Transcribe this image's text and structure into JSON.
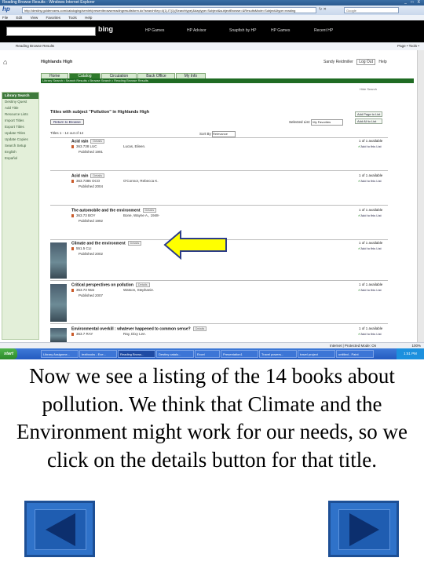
{
  "browser": {
    "window_title": "Reading Browse Results - Windows Internet Explorer",
    "address": "http://destiny.goldenrams.com/cataloging/servlet/presentbrowsereadingresultsform.do?searchKey=4(1).IT(1)(Searchtype)&daytype=Subject&subjectBrowse=&ResultsMode=Subject&type=reading",
    "google_placeholder": "Google",
    "menu": [
      "File",
      "Edit",
      "View",
      "Favorites",
      "Tools",
      "Help"
    ],
    "bing_label": "bing",
    "links": [
      "HP Games",
      "HP Advisor",
      "Snapfish by HP",
      "HP Games",
      "Recent HP"
    ],
    "tab_label": "Reading Browse Results",
    "toolbar_right": "Page • Tools •",
    "window_controls": "_ □ X"
  },
  "site": {
    "name": "Highlands High",
    "user": "Sandy Reidmiller",
    "logout": "Log Out",
    "help": "Help",
    "tabs": [
      "Home",
      "Catalog",
      "Circulation",
      "Back Office",
      "My Info"
    ],
    "active_tab": "Catalog",
    "breadcrumb": "Library Search • Search Results • Browse Search • Reading Browse Results",
    "hide_label": "Hide Search"
  },
  "sidebar": {
    "heading": "Library Search",
    "items": [
      "Destiny Quest",
      "Add Title",
      "Resource Lists",
      "Import Titles",
      "Export Titles",
      "Update Titles",
      "Update Copies",
      "Search Setup",
      "English",
      "Español"
    ]
  },
  "results": {
    "title": "Titles with subject \"Pollution\" in Highlands High",
    "back_link": "Return to Browse",
    "selected_list_label": "Selected List:",
    "selected_list_value": "My Favorites",
    "top_buttons": [
      "Add Page to List",
      "Add All to List"
    ],
    "count_text": "Titles 1 - 14 out of 14",
    "sort_label": "Sort By",
    "sort_value": "Relevance",
    "details_label": "Details",
    "add_to_list_label": "Add to this List",
    "items": [
      {
        "title": "Acid rain",
        "call": "363.738 LUC",
        "author": "Lucas, Eileen.",
        "published": "Published 1991",
        "availability": "1 of 1 available",
        "thumb": false
      },
      {
        "title": "Acid rain",
        "call": "363.7386 OCO",
        "author": "O'Connor, Rebecca K.",
        "published": "Published 2004",
        "availability": "1 of 1 available",
        "thumb": false
      },
      {
        "title": "The automobile and the environment",
        "call": "363.73 BOY",
        "author": "Bone, Wayne A., 1948-",
        "published": "Published 1992",
        "availability": "1 of 1 available",
        "thumb": false
      },
      {
        "title": "Climate and the environment",
        "call": "551.5 CLI",
        "author": "",
        "published": "Published 2002",
        "availability": "1 of 1 available",
        "thumb": true
      },
      {
        "title": "Critical perspectives on pollution",
        "call": "363.73 Wat",
        "author": "Watson, Stephanie.",
        "published": "Published 2007",
        "availability": "1 of 1 available",
        "thumb": true
      },
      {
        "title": "Environmental overkill : whatever happened to common sense?",
        "call": "363.7 RAY",
        "author": "Ray, Dixy Lee.",
        "published": "",
        "availability": "1 of 1 available",
        "thumb": true
      }
    ]
  },
  "status": {
    "zone": "Internet | Protected Mode: On",
    "zoom": "100%"
  },
  "taskbar": {
    "start": "start",
    "tasks": [
      "Library Assignme...",
      "textbooks - Exe...",
      "Reading Brows...",
      "Destiny catalo...",
      "Excel",
      "Presentation1",
      "Travel powers...",
      "travel project",
      "untitled - Paint"
    ],
    "clock": "1:51 PM"
  },
  "caption": "Now we see a listing of the 14 books about pollution.  We think that Climate and the Environment might work for our needs, so we click on the details button for that title.",
  "colors": {
    "arrow_fill": "#ffff00",
    "arrow_stroke": "#2c3c8a",
    "nav_button": "#2f72c9"
  }
}
